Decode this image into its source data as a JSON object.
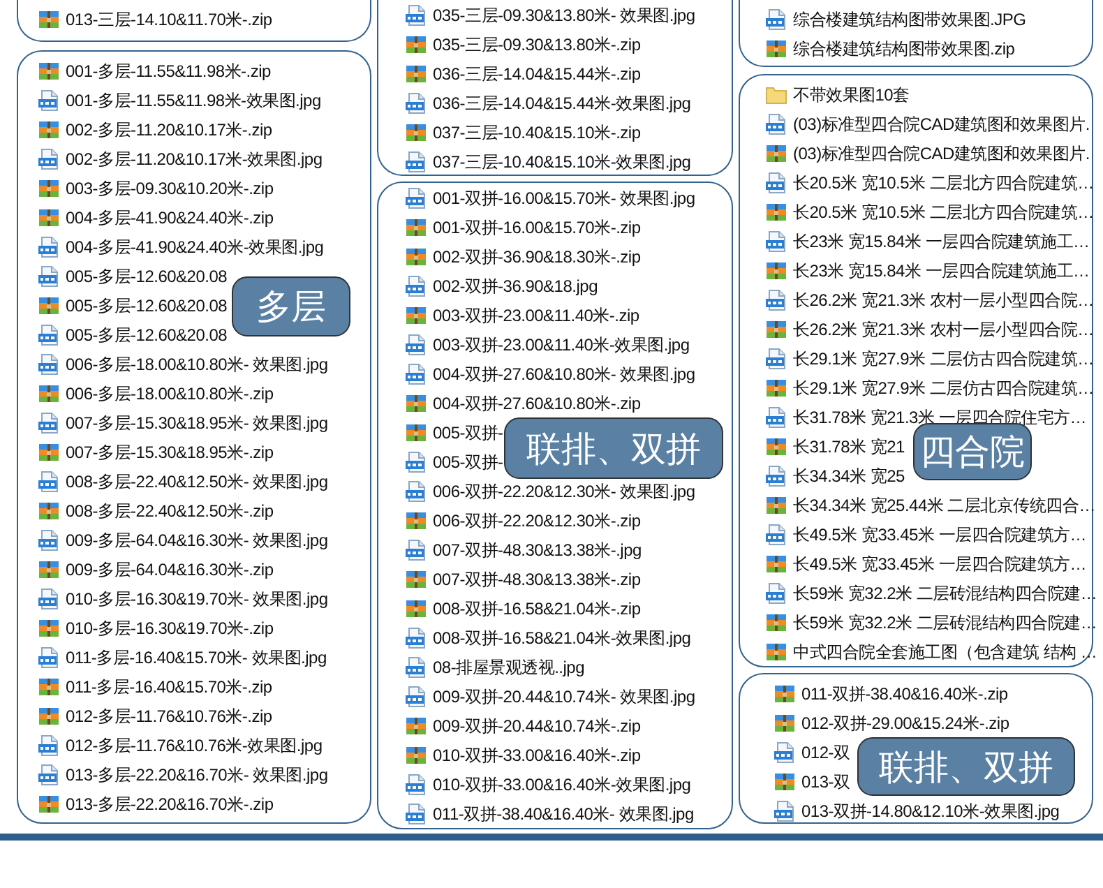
{
  "columns": [
    {
      "panels": [
        {
          "items": [
            {
              "kind": "zip",
              "name": "013-三层-14.10&11.70米-.zip"
            }
          ]
        },
        {
          "label": "多层",
          "items": [
            {
              "kind": "zip",
              "name": "001-多层-11.55&11.98米-.zip"
            },
            {
              "kind": "jpg",
              "name": "001-多层-11.55&11.98米-效果图.jpg"
            },
            {
              "kind": "zip",
              "name": "002-多层-11.20&10.17米-.zip"
            },
            {
              "kind": "jpg",
              "name": "002-多层-11.20&10.17米-效果图.jpg"
            },
            {
              "kind": "zip",
              "name": "003-多层-09.30&10.20米-.zip"
            },
            {
              "kind": "zip",
              "name": "004-多层-41.90&24.40米-.zip"
            },
            {
              "kind": "jpg",
              "name": "004-多层-41.90&24.40米-效果图.jpg"
            },
            {
              "kind": "jpg",
              "name": "005-多层-12.60&20.08"
            },
            {
              "kind": "zip",
              "name": "005-多层-12.60&20.08"
            },
            {
              "kind": "jpg",
              "name": "005-多层-12.60&20.08"
            },
            {
              "kind": "jpg",
              "name": "006-多层-18.00&10.80米- 效果图.jpg"
            },
            {
              "kind": "zip",
              "name": "006-多层-18.00&10.80米-.zip"
            },
            {
              "kind": "jpg",
              "name": "007-多层-15.30&18.95米- 效果图.jpg"
            },
            {
              "kind": "zip",
              "name": "007-多层-15.30&18.95米-.zip"
            },
            {
              "kind": "jpg",
              "name": "008-多层-22.40&12.50米- 效果图.jpg"
            },
            {
              "kind": "zip",
              "name": "008-多层-22.40&12.50米-.zip"
            },
            {
              "kind": "jpg",
              "name": "009-多层-64.04&16.30米- 效果图.jpg"
            },
            {
              "kind": "zip",
              "name": "009-多层-64.04&16.30米-.zip"
            },
            {
              "kind": "jpg",
              "name": "010-多层-16.30&19.70米- 效果图.jpg"
            },
            {
              "kind": "zip",
              "name": "010-多层-16.30&19.70米-.zip"
            },
            {
              "kind": "jpg",
              "name": "011-多层-16.40&15.70米- 效果图.jpg"
            },
            {
              "kind": "zip",
              "name": "011-多层-16.40&15.70米-.zip"
            },
            {
              "kind": "zip",
              "name": "012-多层-11.76&10.76米-.zip"
            },
            {
              "kind": "jpg",
              "name": "012-多层-11.76&10.76米-效果图.jpg"
            },
            {
              "kind": "jpg",
              "name": "013-多层-22.20&16.70米- 效果图.jpg"
            },
            {
              "kind": "zip",
              "name": "013-多层-22.20&16.70米-.zip"
            }
          ]
        }
      ]
    },
    {
      "panels": [
        {
          "items": [
            {
              "kind": "jpg",
              "name": "035-三层-09.30&13.80米- 效果图.jpg"
            },
            {
              "kind": "zip",
              "name": "035-三层-09.30&13.80米-.zip"
            },
            {
              "kind": "zip",
              "name": "036-三层-14.04&15.44米-.zip"
            },
            {
              "kind": "jpg",
              "name": "036-三层-14.04&15.44米-效果图.jpg"
            },
            {
              "kind": "zip",
              "name": "037-三层-10.40&15.10米-.zip"
            },
            {
              "kind": "jpg",
              "name": "037-三层-10.40&15.10米-效果图.jpg"
            }
          ]
        },
        {
          "label": "联排、双拼",
          "items": [
            {
              "kind": "jpg",
              "name": "001-双拼-16.00&15.70米- 效果图.jpg"
            },
            {
              "kind": "zip",
              "name": "001-双拼-16.00&15.70米-.zip"
            },
            {
              "kind": "zip",
              "name": "002-双拼-36.90&18.30米-.zip"
            },
            {
              "kind": "jpg",
              "name": "002-双拼-36.90&18.jpg"
            },
            {
              "kind": "zip",
              "name": "003-双拼-23.00&11.40米-.zip"
            },
            {
              "kind": "jpg",
              "name": "003-双拼-23.00&11.40米-效果图.jpg"
            },
            {
              "kind": "jpg",
              "name": "004-双拼-27.60&10.80米- 效果图.jpg"
            },
            {
              "kind": "zip",
              "name": "004-双拼-27.60&10.80米-.zip"
            },
            {
              "kind": "zip",
              "name": "005-双拼-"
            },
            {
              "kind": "jpg",
              "name": "005-双拼-"
            },
            {
              "kind": "jpg",
              "name": "006-双拼-22.20&12.30米- 效果图.jpg"
            },
            {
              "kind": "zip",
              "name": "006-双拼-22.20&12.30米-.zip"
            },
            {
              "kind": "jpg",
              "name": "007-双拼-48.30&13.38米-.jpg"
            },
            {
              "kind": "zip",
              "name": "007-双拼-48.30&13.38米-.zip"
            },
            {
              "kind": "zip",
              "name": "008-双拼-16.58&21.04米-.zip"
            },
            {
              "kind": "jpg",
              "name": "008-双拼-16.58&21.04米-效果图.jpg"
            },
            {
              "kind": "jpg",
              "name": "08-排屋景观透视..jpg"
            },
            {
              "kind": "jpg",
              "name": "009-双拼-20.44&10.74米- 效果图.jpg"
            },
            {
              "kind": "zip",
              "name": "009-双拼-20.44&10.74米-.zip"
            },
            {
              "kind": "zip",
              "name": "010-双拼-33.00&16.40米-.zip"
            },
            {
              "kind": "jpg",
              "name": "010-双拼-33.00&16.40米-效果图.jpg"
            },
            {
              "kind": "jpg",
              "name": "011-双拼-38.40&16.40米- 效果图.jpg"
            }
          ]
        }
      ]
    },
    {
      "panels": [
        {
          "items": [
            {
              "kind": "jpg",
              "name": "综合楼建筑结构图带效果图.JPG"
            },
            {
              "kind": "zip",
              "name": "综合楼建筑结构图带效果图.zip"
            }
          ]
        },
        {
          "label": "四合院",
          "items": [
            {
              "kind": "folder",
              "name": "不带效果图10套"
            },
            {
              "kind": "jpg",
              "name": "(03)标准型四合院CAD建筑图和效果图片."
            },
            {
              "kind": "zip",
              "name": "(03)标准型四合院CAD建筑图和效果图片."
            },
            {
              "kind": "jpg",
              "name": "长20.5米 宽10.5米 二层北方四合院建筑…"
            },
            {
              "kind": "zip",
              "name": "长20.5米 宽10.5米 二层北方四合院建筑…"
            },
            {
              "kind": "jpg",
              "name": "长23米 宽15.84米 一层四合院建筑施工…"
            },
            {
              "kind": "zip",
              "name": "长23米 宽15.84米 一层四合院建筑施工…"
            },
            {
              "kind": "jpg",
              "name": "长26.2米 宽21.3米 农村一层小型四合院…"
            },
            {
              "kind": "zip",
              "name": "长26.2米 宽21.3米 农村一层小型四合院…"
            },
            {
              "kind": "jpg",
              "name": "长29.1米 宽27.9米 二层仿古四合院建筑…"
            },
            {
              "kind": "zip",
              "name": "长29.1米 宽27.9米 二层仿古四合院建筑…"
            },
            {
              "kind": "jpg",
              "name": "长31.78米 宽21.3米 一层四合院住宅方…"
            },
            {
              "kind": "zip",
              "name": "长31.78米 宽21"
            },
            {
              "kind": "jpg",
              "name": "长34.34米 宽25"
            },
            {
              "kind": "zip",
              "name": "长34.34米 宽25.44米 二层北京传统四合…"
            },
            {
              "kind": "jpg",
              "name": "长49.5米 宽33.45米 一层四合院建筑方…"
            },
            {
              "kind": "zip",
              "name": "长49.5米 宽33.45米 一层四合院建筑方…"
            },
            {
              "kind": "jpg",
              "name": "长59米 宽32.2米 二层砖混结构四合院建…"
            },
            {
              "kind": "zip",
              "name": "长59米 宽32.2米 二层砖混结构四合院建…"
            },
            {
              "kind": "zip",
              "name": "中式四合院全套施工图（包含建筑 结构 …"
            }
          ]
        },
        {
          "label": "联排、双拼",
          "items": [
            {
              "kind": "zip",
              "name": "011-双拼-38.40&16.40米-.zip"
            },
            {
              "kind": "zip",
              "name": "012-双拼-29.00&15.24米-.zip"
            },
            {
              "kind": "jpg",
              "name": "012-双"
            },
            {
              "kind": "zip",
              "name": "013-双"
            },
            {
              "kind": "jpg",
              "name": "013-双拼-14.80&12.10米-效果图.jpg"
            }
          ]
        }
      ]
    }
  ]
}
